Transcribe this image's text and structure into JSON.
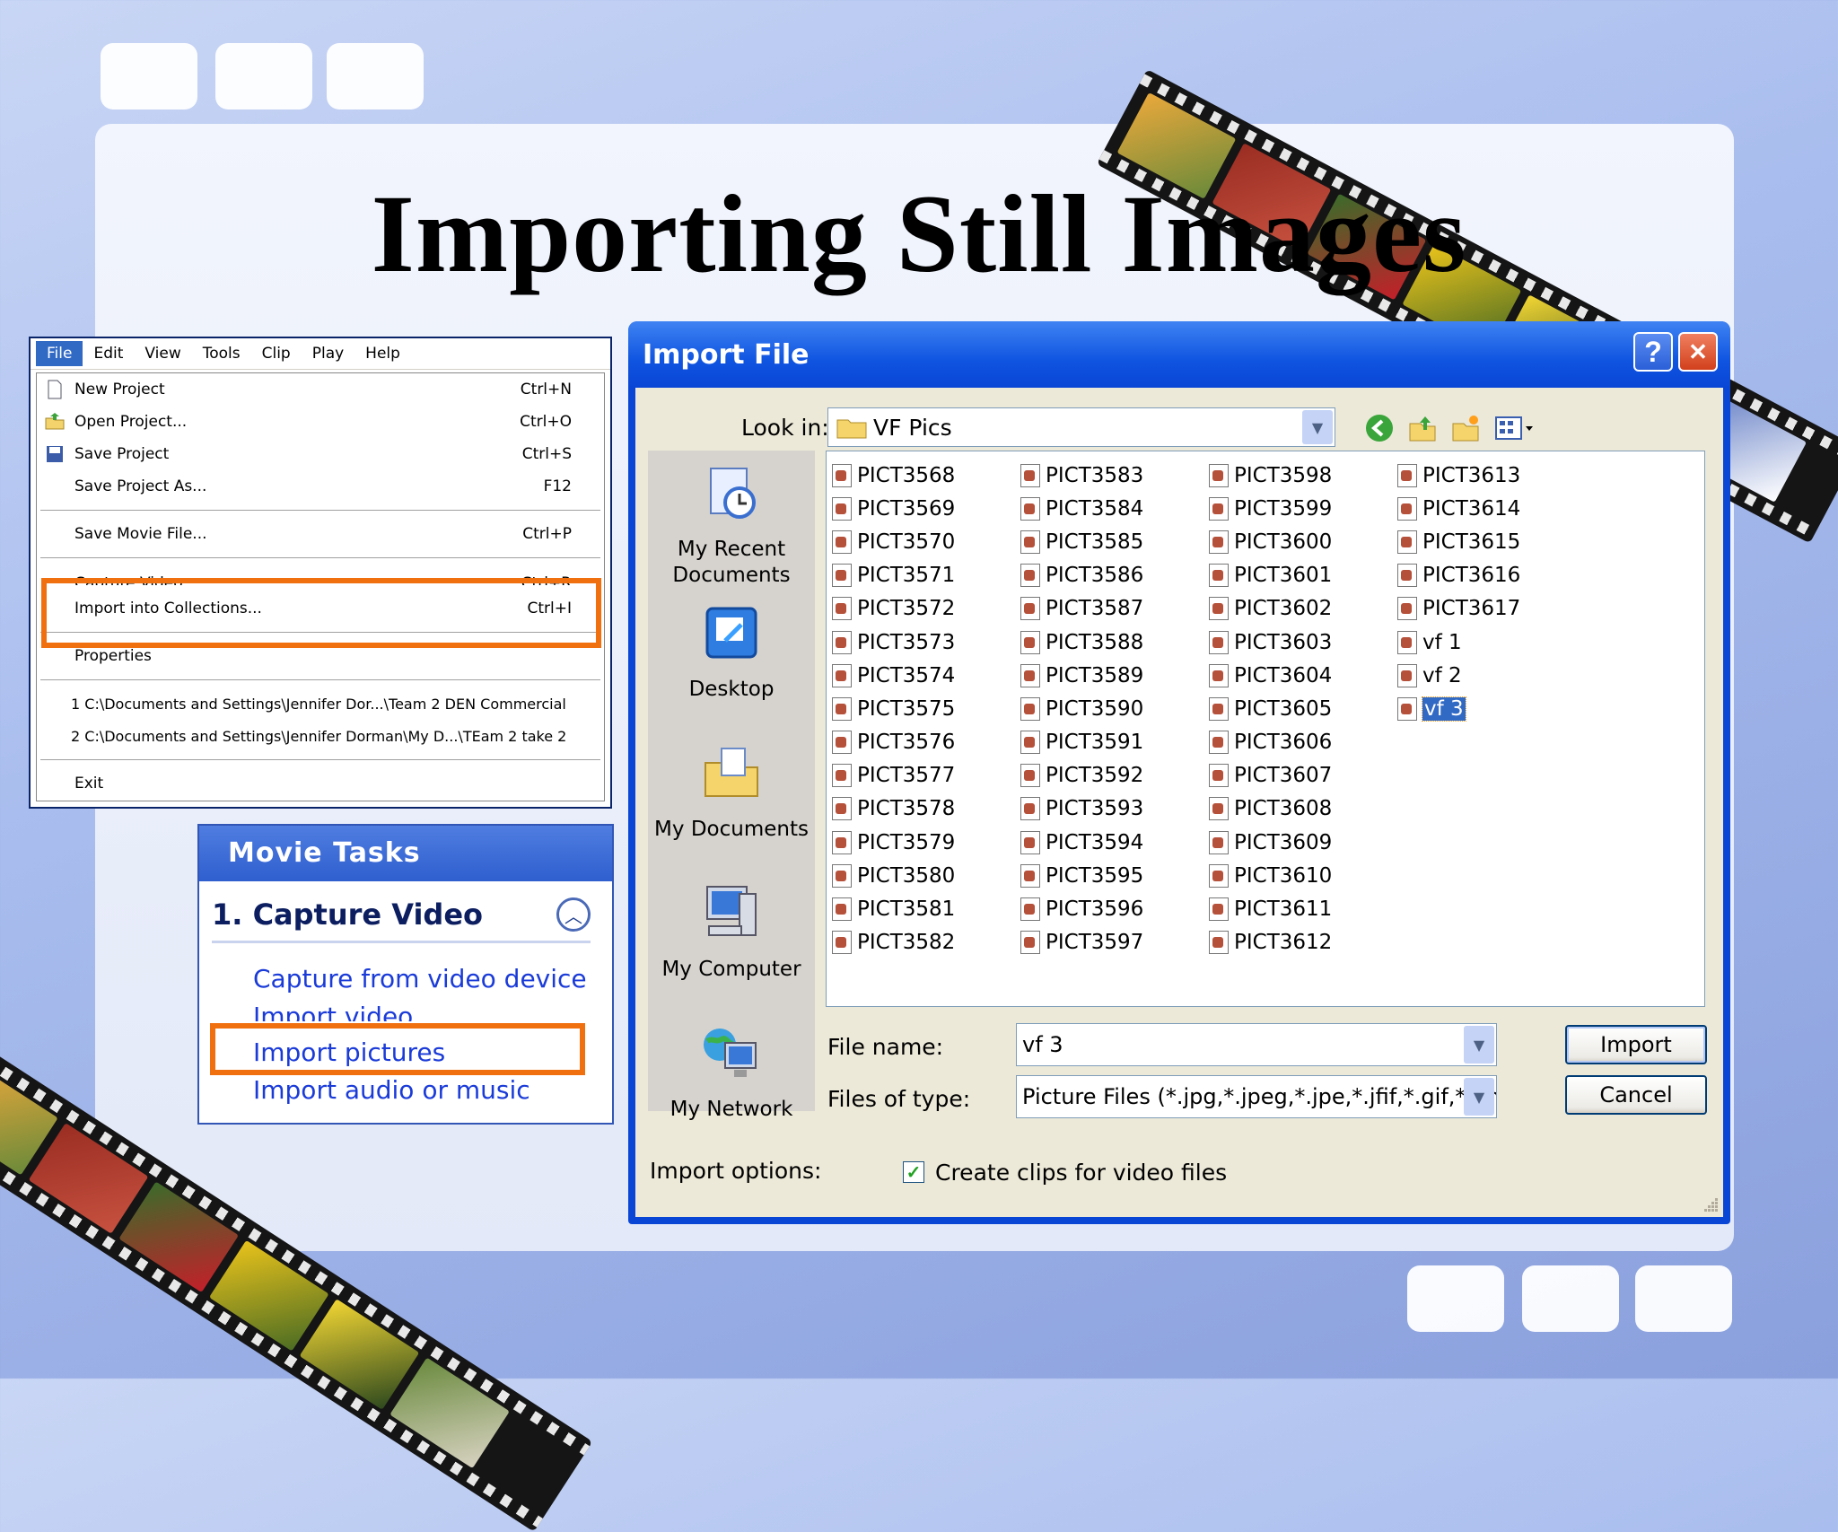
{
  "slide": {
    "title": "Importing Still Images"
  },
  "menu": {
    "bar": [
      "File",
      "Edit",
      "View",
      "Tools",
      "Clip",
      "Play",
      "Help"
    ],
    "items": [
      {
        "label": "New Project",
        "shortcut": "Ctrl+N"
      },
      {
        "label": "Open Project...",
        "shortcut": "Ctrl+O"
      },
      {
        "label": "Save Project",
        "shortcut": "Ctrl+S"
      },
      {
        "label": "Save Project As...",
        "shortcut": "F12"
      },
      {
        "label": "Save Movie File...",
        "shortcut": "Ctrl+P"
      },
      {
        "label": "Capture Video...",
        "shortcut": "Ctrl+R"
      },
      {
        "label": "Import into Collections...",
        "shortcut": "Ctrl+I"
      },
      {
        "label": "Properties",
        "shortcut": ""
      },
      {
        "label": "1 C:\\Documents and Settings\\Jennifer Dor...\\Team 2 DEN Commercial",
        "shortcut": ""
      },
      {
        "label": "2 C:\\Documents and Settings\\Jennifer Dorman\\My D...\\TEam 2 take 2",
        "shortcut": ""
      },
      {
        "label": "Exit",
        "shortcut": ""
      }
    ]
  },
  "tasks": {
    "header": "Movie Tasks",
    "section": "1. Capture Video",
    "links": [
      "Capture from video device",
      "Import video",
      "Import pictures",
      "Import audio or music"
    ]
  },
  "dialog": {
    "title": "Import File",
    "help_btn": "?",
    "close_btn": "✕",
    "look_in_label": "Look in:",
    "look_in_value": "VF Pics",
    "places": [
      "My Recent Documents",
      "Desktop",
      "My Documents",
      "My Computer",
      "My Network"
    ],
    "files": [
      [
        "PICT3568",
        "PICT3569",
        "PICT3570",
        "PICT3571",
        "PICT3572",
        "PICT3573",
        "PICT3574",
        "PICT3575",
        "PICT3576",
        "PICT3577",
        "PICT3578",
        "PICT3579",
        "PICT3580",
        "PICT3581",
        "PICT3582"
      ],
      [
        "PICT3583",
        "PICT3584",
        "PICT3585",
        "PICT3586",
        "PICT3587",
        "PICT3588",
        "PICT3589",
        "PICT3590",
        "PICT3591",
        "PICT3592",
        "PICT3593",
        "PICT3594",
        "PICT3595",
        "PICT3596",
        "PICT3597"
      ],
      [
        "PICT3598",
        "PICT3599",
        "PICT3600",
        "PICT3601",
        "PICT3602",
        "PICT3603",
        "PICT3604",
        "PICT3605",
        "PICT3606",
        "PICT3607",
        "PICT3608",
        "PICT3609",
        "PICT3610",
        "PICT3611",
        "PICT3612"
      ],
      [
        "PICT3613",
        "PICT3614",
        "PICT3615",
        "PICT3616",
        "PICT3617",
        "vf 1",
        "vf 2",
        "vf 3"
      ]
    ],
    "selected_file": "vf 3",
    "file_name_label": "File name:",
    "file_name_value": "vf 3",
    "file_type_label": "Files of type:",
    "file_type_value": "Picture Files (*.jpg,*.jpeg,*.jpe,*.jfif,*.gif,*.png,*.bmp)",
    "import_btn": "Import",
    "cancel_btn": "Cancel",
    "options_label": "Import options:",
    "checkbox_label": "Create clips for video files",
    "checkbox_checked": true
  },
  "colors": {
    "highlight": "#f07010",
    "xp_blue": "#0a46d6",
    "link": "#1a3bd8"
  }
}
